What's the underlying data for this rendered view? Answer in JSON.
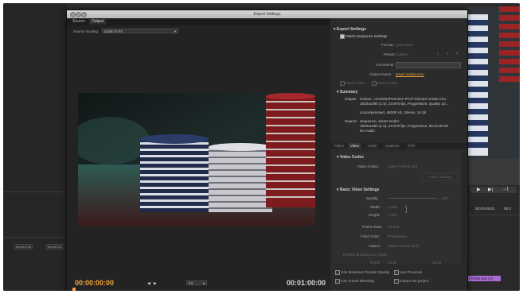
{
  "window": {
    "title": "Export Settings"
  },
  "left_panel": {
    "tabs": [
      "Source",
      "Output"
    ],
    "active_tab": 1,
    "source_scaling_label": "Source Scaling:",
    "source_scaling_value": "Scale To Fit",
    "timecode_start": "00:00:00:00",
    "timecode_end": "00:01:00:00",
    "fit_value": "Fit",
    "accent": "#f2a43a"
  },
  "export_settings": {
    "header": "Export Settings",
    "match_sequence": "Match Sequence Settings",
    "format_label": "Format:",
    "format_value": "QuickTime",
    "preset_label": "Preset:",
    "preset_value": "Custom",
    "comments_label": "Comments:",
    "output_name_label": "Output Name:",
    "output_name_value": "smart render.mov",
    "export_video": "Export Video",
    "export_audio": "Export Audio",
    "summary_header": "Summary",
    "output_label": "Output:",
    "output_line1": "/Users/...o/Adobe/Premiere Pro/7.0/smart render.mov",
    "output_line2": "1920x1080 (1.0), 23.976 fps, Progressive, Quality 10...",
    "output_line3": "Uncompressed, 48000 Hz, Stereo, 16 bit",
    "source_label": "Source:",
    "source_line1": "Sequence, smart render",
    "source_line2": "1920x1080 (1.0), 23.976 fps, Progressive, 00:01:00:00",
    "source_line3": "No Audio"
  },
  "tabs": [
    "Filters",
    "Video",
    "Audio",
    "Captions",
    "FTP"
  ],
  "active_tab": "Video",
  "video_codec": {
    "header": "Video Codec",
    "codec_label": "Video Codec:",
    "codec_value": "Apple ProRes 422",
    "codec_settings": "Codec Settings"
  },
  "basic_video": {
    "header": "Basic Video Settings",
    "quality_label": "Quality:",
    "quality_value": "100",
    "width_label": "Width:",
    "width_value": "1,920",
    "height_label": "Height:",
    "height_value": "1,080",
    "frame_rate_label": "Frame Rate:",
    "frame_rate_value": "23.976",
    "field_order_label": "Field Order:",
    "field_order_value": "Progressive",
    "aspect_label": "Aspect:",
    "aspect_value": "Square Pixels (1.0)",
    "render_max_depth": "Render at Maximum Depth",
    "depth_label": "Depth:",
    "depth_value": "24 bit",
    "depth_alt": "32 bit"
  },
  "bottom_options": {
    "max_render_quality": "Use Maximum Render Quality",
    "use_previews": "Use Previews",
    "frame_blending": "Use Frame Blending",
    "import_into_project": "Import into project"
  },
  "background": {
    "media_end": "Media End",
    "media_du": "Media Du",
    "timecode_right": "00:00:49:22",
    "timecode_right2": "00:0",
    "clip_name": "VTXHD.mov [V]"
  }
}
